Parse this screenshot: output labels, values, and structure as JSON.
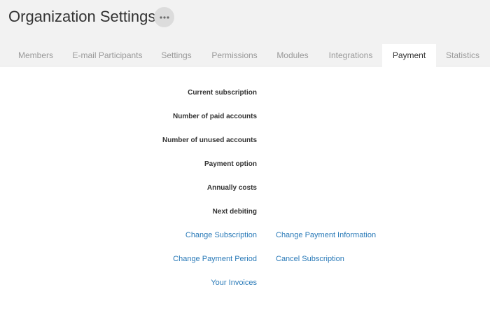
{
  "header": {
    "title": "Organization Settings",
    "more_icon": "more-horizontal-icon"
  },
  "tabs": [
    {
      "label": "Members",
      "active": false
    },
    {
      "label": "E-mail Participants",
      "active": false
    },
    {
      "label": "Settings",
      "active": false
    },
    {
      "label": "Permissions",
      "active": false
    },
    {
      "label": "Modules",
      "active": false
    },
    {
      "label": "Integrations",
      "active": false
    },
    {
      "label": "Payment",
      "active": true
    },
    {
      "label": "Statistics",
      "active": false
    }
  ],
  "payment": {
    "fields": [
      {
        "label": "Current subscription",
        "value": ""
      },
      {
        "label": "Number of paid accounts",
        "value": ""
      },
      {
        "label": "Number of unused accounts",
        "value": ""
      },
      {
        "label": "Payment option",
        "value": ""
      },
      {
        "label": "Annually costs",
        "value": ""
      },
      {
        "label": "Next debiting",
        "value": ""
      }
    ],
    "links": {
      "change_subscription": "Change Subscription",
      "change_payment_information": "Change Payment Information",
      "change_payment_period": "Change Payment Period",
      "cancel_subscription": "Cancel Subscription",
      "your_invoices": "Your Invoices"
    }
  },
  "colors": {
    "header_bg": "#f2f2f2",
    "link": "#2a7ab8",
    "tab_inactive": "#999999",
    "text": "#333333"
  }
}
